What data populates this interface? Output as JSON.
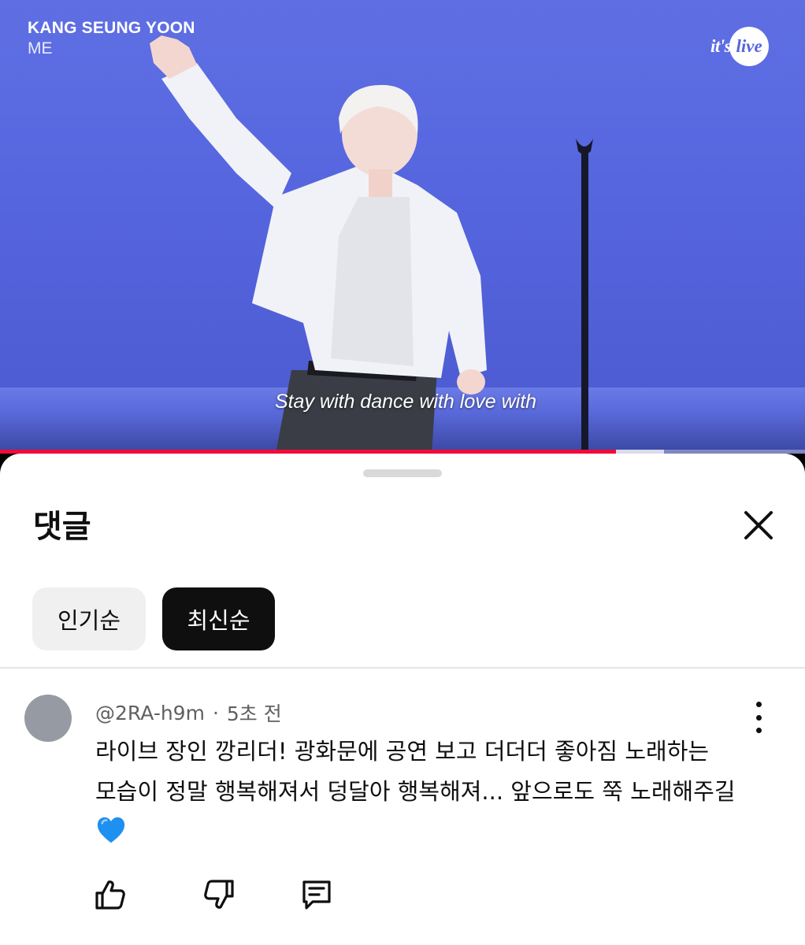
{
  "video": {
    "artist": "KANG SEUNG YOON",
    "song": "ME",
    "logo_text": "it's",
    "logo_circle_text": "live",
    "subtitle": "Stay with dance with love with",
    "progress_fraction": 0.765,
    "buffered_fraction": 0.825,
    "colors": {
      "background": "#5565de",
      "progress": "#f00b3a"
    }
  },
  "comments_sheet": {
    "title": "댓글",
    "close_icon": "close-icon",
    "sort_chips": [
      {
        "label": "인기순",
        "selected": false
      },
      {
        "label": "최신순",
        "selected": true
      }
    ],
    "comments": [
      {
        "author": "@2RA-h9m",
        "separator": "·",
        "time": "5초 전",
        "text": "라이브 장인 깡리더! 광화문에 공연 보고 더더더 좋아짐 노래하는 모습이 정말 행복해져서 덩달아 행복해져... 앞으로도 쭉 노래해주길",
        "emoji": "blue-heart-icon",
        "actions": [
          "thumbs-up-icon",
          "thumbs-down-icon",
          "reply-icon"
        ]
      }
    ]
  }
}
